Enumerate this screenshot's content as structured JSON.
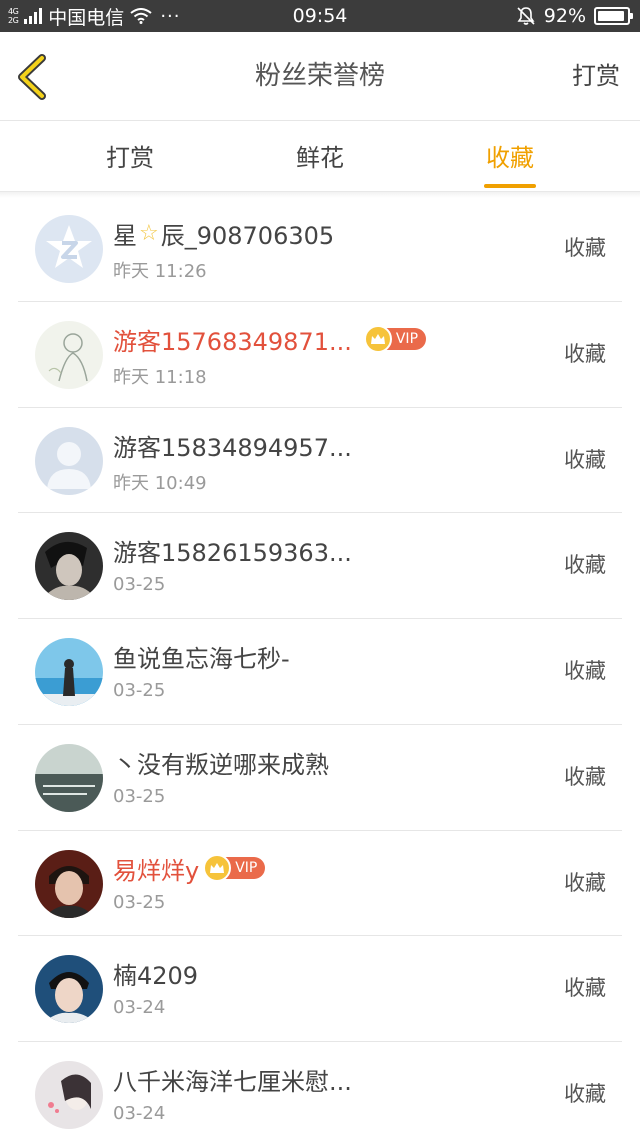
{
  "status_bar": {
    "net_tags": [
      "4G",
      "2G"
    ],
    "carrier": "中国电信",
    "dots": "···",
    "time": "09:54",
    "battery": "92%",
    "battery_level": 0.92
  },
  "header": {
    "title": "粉丝荣誉榜",
    "right_action": "打赏"
  },
  "tabs": [
    {
      "label": "打赏",
      "active": false
    },
    {
      "label": "鲜花",
      "active": false
    },
    {
      "label": "收藏",
      "active": true
    }
  ],
  "colors": {
    "accent": "#f0a000",
    "vip_name": "#e2513c",
    "vip_badge": "#ea6a4a"
  },
  "list": [
    {
      "name_a": "星",
      "name_b": "辰_908706305",
      "time": "昨天 11:26",
      "action": "收藏",
      "avatar": "qq-default-icon"
    },
    {
      "name": "游客15768349871...",
      "vip": "VIP",
      "time": "昨天 11:18",
      "action": "收藏",
      "avatar": "sketch-photo"
    },
    {
      "name": "游客15834894957...",
      "time": "昨天 10:49",
      "action": "收藏",
      "avatar": "default-user-icon"
    },
    {
      "name": "游客15826159363...",
      "time": "03-25",
      "action": "收藏",
      "avatar": "portrait-photo"
    },
    {
      "name": "鱼说鱼忘海七秒-",
      "time": "03-25",
      "action": "收藏",
      "avatar": "sea-photo"
    },
    {
      "name": "丶没有叛逆哪来成熟",
      "time": "03-25",
      "action": "收藏",
      "avatar": "text-photo"
    },
    {
      "name": "易烊烊y",
      "vip": "VIP",
      "time": "03-25",
      "action": "收藏",
      "avatar": "portrait-photo"
    },
    {
      "name": "楠4209",
      "time": "03-24",
      "action": "收藏",
      "avatar": "portrait-photo"
    },
    {
      "name": "八千米海洋七厘米慰...",
      "time": "03-24",
      "action": "收藏",
      "avatar": "illustration-photo"
    }
  ]
}
